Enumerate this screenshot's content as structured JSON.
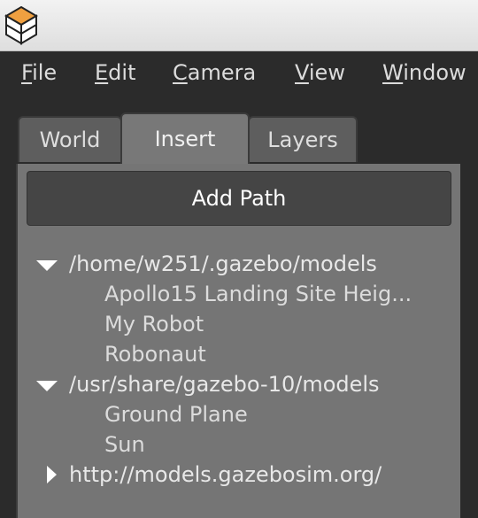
{
  "menubar": {
    "items": [
      {
        "mnemonic": "F",
        "rest": "ile"
      },
      {
        "mnemonic": "E",
        "rest": "dit"
      },
      {
        "mnemonic": "C",
        "rest": "amera"
      },
      {
        "mnemonic": "V",
        "rest": "iew"
      },
      {
        "mnemonic": "W",
        "rest": "indow"
      }
    ]
  },
  "tabs": [
    {
      "label": "World",
      "active": false
    },
    {
      "label": "Insert",
      "active": true
    },
    {
      "label": "Layers",
      "active": false
    }
  ],
  "insert_panel": {
    "add_path_label": "Add Path",
    "tree": [
      {
        "path": "/home/w251/.gazebo/models",
        "expanded": true,
        "models": [
          "Apollo15 Landing Site Heig...",
          "My Robot",
          "Robonaut"
        ]
      },
      {
        "path": "/usr/share/gazebo-10/models",
        "expanded": true,
        "models": [
          "Ground Plane",
          "Sun"
        ]
      },
      {
        "path": "http://models.gazebosim.org/",
        "expanded": false,
        "models": []
      }
    ]
  },
  "colors": {
    "background": "#2b2b2b",
    "panel": "#757575",
    "button": "#454545",
    "icon_orange": "#f0a040"
  },
  "icons": {
    "app": "gazebo-app-icon",
    "expanded": "triangle-down-icon",
    "collapsed": "triangle-right-icon"
  }
}
